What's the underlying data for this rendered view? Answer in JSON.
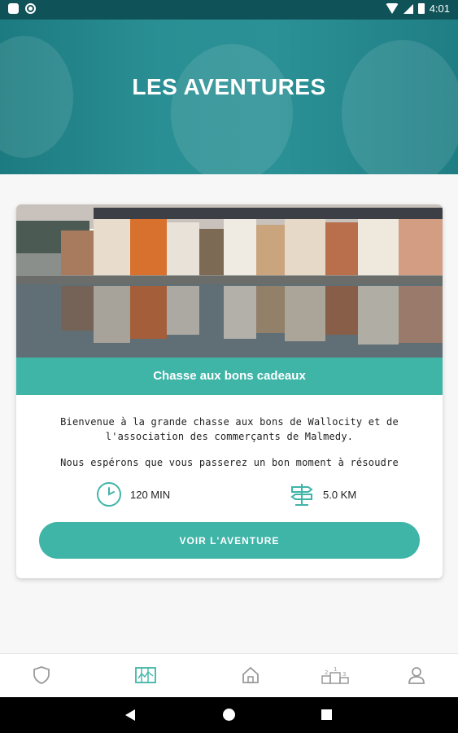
{
  "status_bar": {
    "time": "4:01"
  },
  "header": {
    "title": "LES AVENTURES"
  },
  "card": {
    "title": "Chasse aux bons cadeaux",
    "description_1": "Bienvenue à la grande chasse aux bons de Wallocity et de l'association des commerçants de Malmedy.",
    "description_2": "Nous espérons que vous passerez un bon moment à résoudre",
    "duration": "120 MIN",
    "distance": "5.0 KM",
    "cta_label": "VOIR L'AVENTURE"
  },
  "bottom_nav": {
    "items": [
      {
        "icon": "shield-icon",
        "active": false
      },
      {
        "icon": "map-icon",
        "active": true
      },
      {
        "icon": "home-icon",
        "active": false
      },
      {
        "icon": "podium-icon",
        "active": false
      },
      {
        "icon": "user-icon",
        "active": false
      }
    ]
  },
  "colors": {
    "accent": "#3fb5a8",
    "header": "#2a8f94",
    "inactive_icon": "#9a9a9a"
  }
}
